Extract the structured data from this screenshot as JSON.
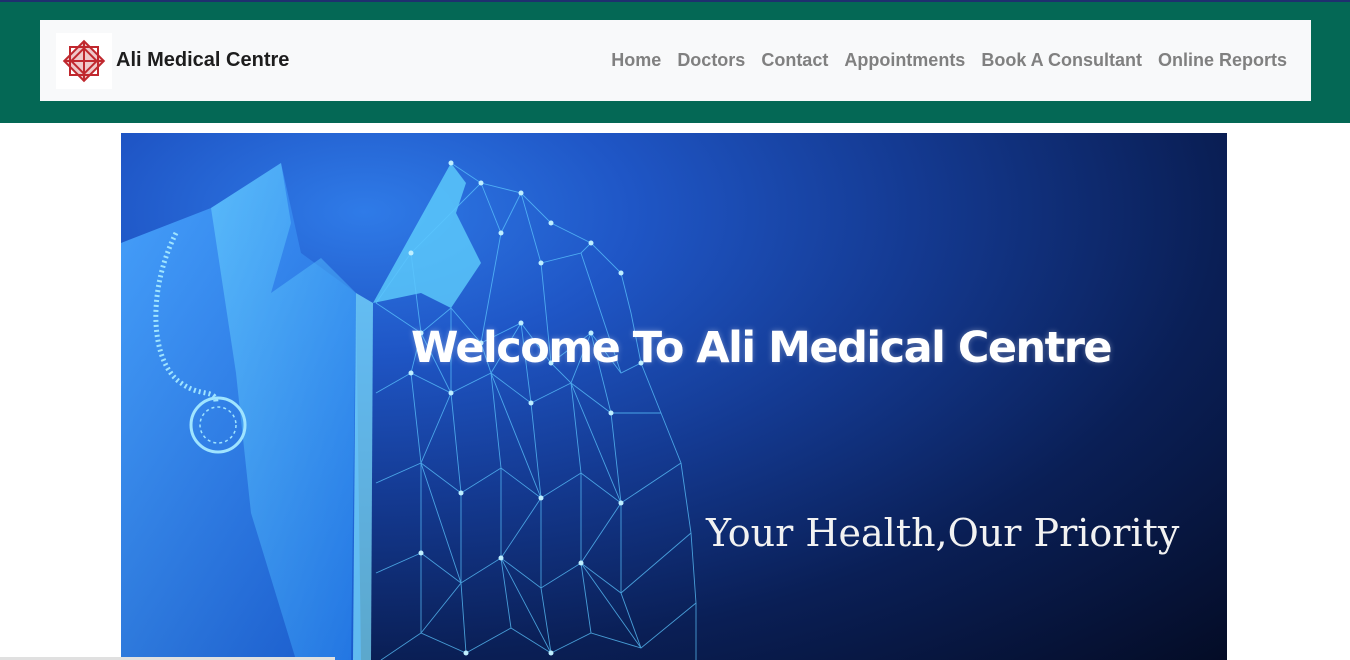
{
  "brand": {
    "name": "Ali Medical Centre",
    "logo_icon": "red-geometric-star-logo"
  },
  "nav": {
    "items": [
      {
        "label": "Home"
      },
      {
        "label": "Doctors"
      },
      {
        "label": "Contact"
      },
      {
        "label": "Appointments"
      },
      {
        "label": "Book A Consultant"
      },
      {
        "label": "Online Reports"
      }
    ]
  },
  "hero": {
    "title": "Welcome To Ali Medical Centre",
    "subtitle": "Your Health,Our Priority",
    "image_icon": "doctor-coat-stethoscope-network-illustration"
  },
  "colors": {
    "header_band": "#046855",
    "navbar_bg": "#f8f9fa",
    "nav_text": "#808080",
    "brand_text": "#1d1d1d",
    "logo_red": "#c0282e",
    "hero_dark": "#040c26",
    "hero_blue": "#1f56c6"
  }
}
